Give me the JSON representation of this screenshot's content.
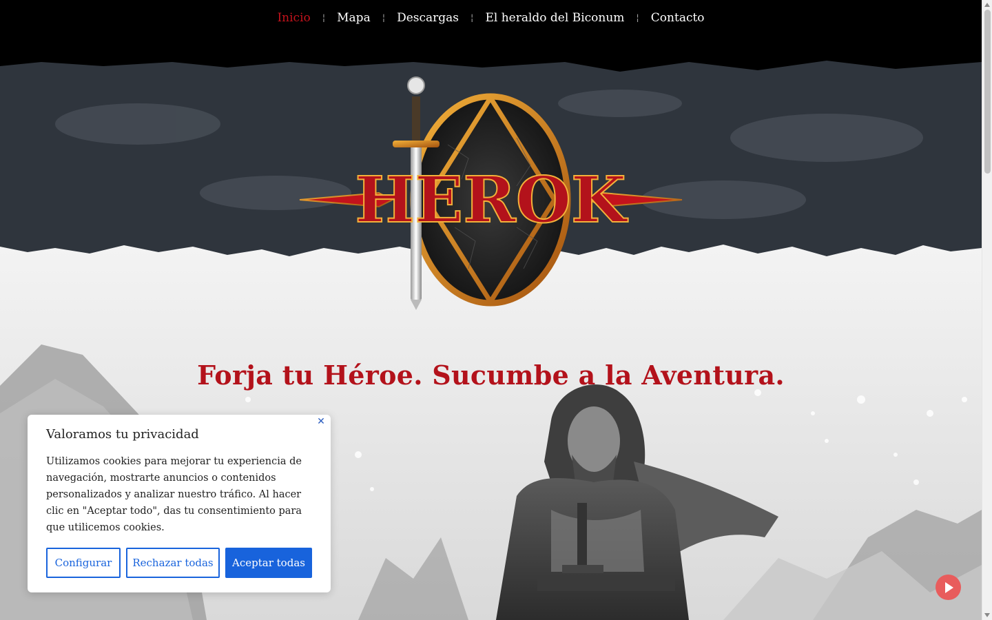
{
  "nav": {
    "items": [
      {
        "label": "Inicio",
        "active": true
      },
      {
        "label": "Mapa",
        "active": false
      },
      {
        "label": "Descargas",
        "active": false
      },
      {
        "label": "El heraldo del Biconum",
        "active": false
      },
      {
        "label": "Contacto",
        "active": false
      }
    ],
    "separator": "¦"
  },
  "hero": {
    "logo_text": "HEROK",
    "tagline": "Forja tu Héroe. Sucumbe a la Aventura."
  },
  "cookie": {
    "title": "Valoramos tu privacidad",
    "body": "Utilizamos cookies para mejorar tu experiencia de navegación, mostrarte anuncios o contenidos personalizados y analizar nuestro tráfico. Al hacer clic en \"Aceptar todo\", das tu consentimiento para que utilicemos cookies.",
    "configure_label": "Configurar",
    "reject_label": "Rechazar todas",
    "accept_label": "Aceptar todas",
    "close_icon": "close-icon"
  },
  "colors": {
    "accent_red": "#c4131c",
    "cookie_blue": "#1863dc",
    "play_red": "#e85c5c"
  }
}
